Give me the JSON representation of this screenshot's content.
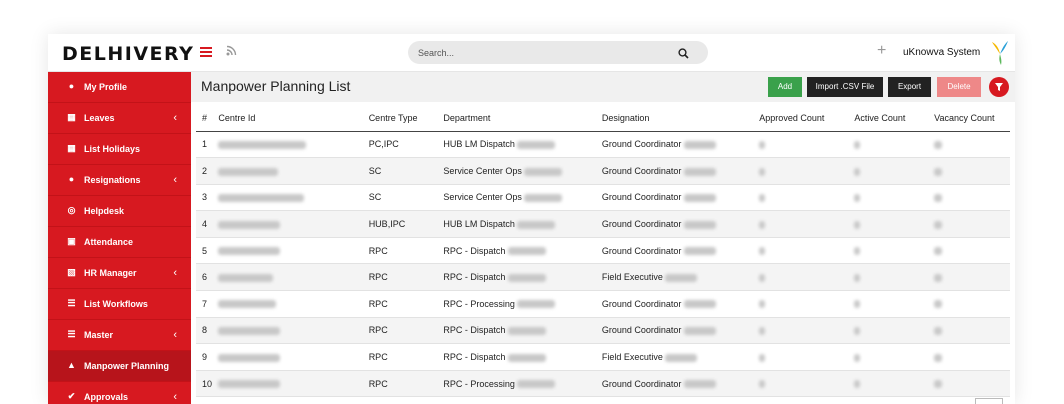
{
  "brand": {
    "logo_text": "DELHIVERY",
    "system_name": "uKnowva System"
  },
  "search": {
    "placeholder": "Search..."
  },
  "icons": {
    "menu": "hamburger-icon",
    "feed": "rss-icon",
    "search": "search-icon",
    "add": "plus-icon",
    "filter": "filter-icon"
  },
  "colors": {
    "primary": "#d71920",
    "add_button": "#3aa14b",
    "dark_button": "#222222",
    "delete_button": "#ee8888"
  },
  "sidebar": {
    "items": [
      {
        "label": "My Profile",
        "icon": "user-icon",
        "has_submenu": false
      },
      {
        "label": "Leaves",
        "icon": "calendar-icon",
        "has_submenu": true
      },
      {
        "label": "List Holidays",
        "icon": "calendar-icon",
        "has_submenu": false
      },
      {
        "label": "Resignations",
        "icon": "user-remove-icon",
        "has_submenu": true
      },
      {
        "label": "Helpdesk",
        "icon": "lifebuoy-icon",
        "has_submenu": false
      },
      {
        "label": "Attendance",
        "icon": "calendar-check-icon",
        "has_submenu": false
      },
      {
        "label": "HR Manager",
        "icon": "id-card-icon",
        "has_submenu": true
      },
      {
        "label": "List Workflows",
        "icon": "list-icon",
        "has_submenu": false
      },
      {
        "label": "Master",
        "icon": "list-alt-icon",
        "has_submenu": true
      },
      {
        "label": "Manpower Planning",
        "icon": "sitemap-icon",
        "has_submenu": false,
        "active": true
      },
      {
        "label": "Approvals",
        "icon": "check-icon",
        "has_submenu": true
      }
    ]
  },
  "page": {
    "title": "Manpower Planning List",
    "buttons": {
      "add": "Add",
      "import": "Import .CSV File",
      "export": "Export",
      "delete": "Delete"
    }
  },
  "table": {
    "columns": [
      "#",
      "Centre Id",
      "Centre Type",
      "Department",
      "Designation",
      "Approved Count",
      "Active Count",
      "Vacancy Count"
    ],
    "rows": [
      {
        "num": "1",
        "centre_type": "PC,IPC",
        "department": "HUB LM Dispatch",
        "designation": "Ground Coordinator"
      },
      {
        "num": "2",
        "centre_type": "SC",
        "department": "Service Center Ops",
        "designation": "Ground Coordinator"
      },
      {
        "num": "3",
        "centre_type": "SC",
        "department": "Service Center Ops",
        "designation": "Ground Coordinator"
      },
      {
        "num": "4",
        "centre_type": "HUB,IPC",
        "department": "HUB LM Dispatch",
        "designation": "Ground Coordinator"
      },
      {
        "num": "5",
        "centre_type": "RPC",
        "department": "RPC - Dispatch",
        "designation": "Ground Coordinator"
      },
      {
        "num": "6",
        "centre_type": "RPC",
        "department": "RPC - Dispatch",
        "designation": "Field Executive"
      },
      {
        "num": "7",
        "centre_type": "RPC",
        "department": "RPC - Processing",
        "designation": "Ground Coordinator"
      },
      {
        "num": "8",
        "centre_type": "RPC",
        "department": "RPC - Dispatch",
        "designation": "Ground Coordinator"
      },
      {
        "num": "9",
        "centre_type": "RPC",
        "department": "RPC - Dispatch",
        "designation": "Field Executive"
      },
      {
        "num": "10",
        "centre_type": "RPC",
        "department": "RPC - Processing",
        "designation": "Ground Coordinator"
      }
    ]
  }
}
